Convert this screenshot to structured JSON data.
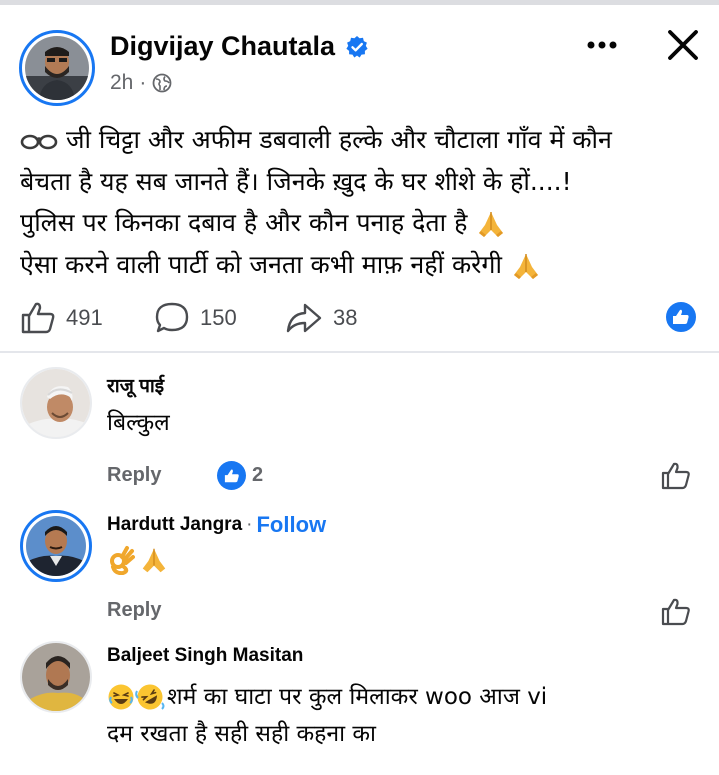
{
  "post": {
    "author": "Digvijay Chautala",
    "time": "2h",
    "lines": [
      "जी चिट्टा और अफीम डबवाली हल्के और चौटाला गाँव में कौन",
      "बेचता है यह सब जानते हैं। जिनके ख़ुद के घर शीशे के हों....!",
      "पुलिस पर किनका दबाव है और कौन पनाह देता है",
      "ऐसा करने वाली पार्टी को जनता कभी माफ़ नहीं करेगी"
    ],
    "likes": "491",
    "comments": "150",
    "shares": "38"
  },
  "comments": [
    {
      "name": "राजू पाई",
      "text": "बिल्कुल",
      "reply_label": "Reply",
      "reaction_count": "2"
    },
    {
      "name": "Hardutt Jangra",
      "follow_label": "Follow",
      "reply_label": "Reply"
    },
    {
      "name": "Baljeet Singh Masitan",
      "text_line1": "शर्म का घाटा  पर कुल मिलाकर  woo आज vi",
      "text_line2": "दम रखता है सही सही कहना  का"
    }
  ],
  "colors": {
    "accent": "#1877f2",
    "muted": "#65676b",
    "text": "#050505"
  },
  "icons": [
    "glasses-icon",
    "verified-badge-icon",
    "globe-icon",
    "more-icon",
    "close-icon",
    "like-icon",
    "comment-icon",
    "share-icon",
    "like-reaction-icon",
    "folded-hands-icon",
    "ok-hand-icon",
    "laughing-emoji-icon",
    "rolling-laughing-emoji-icon"
  ]
}
